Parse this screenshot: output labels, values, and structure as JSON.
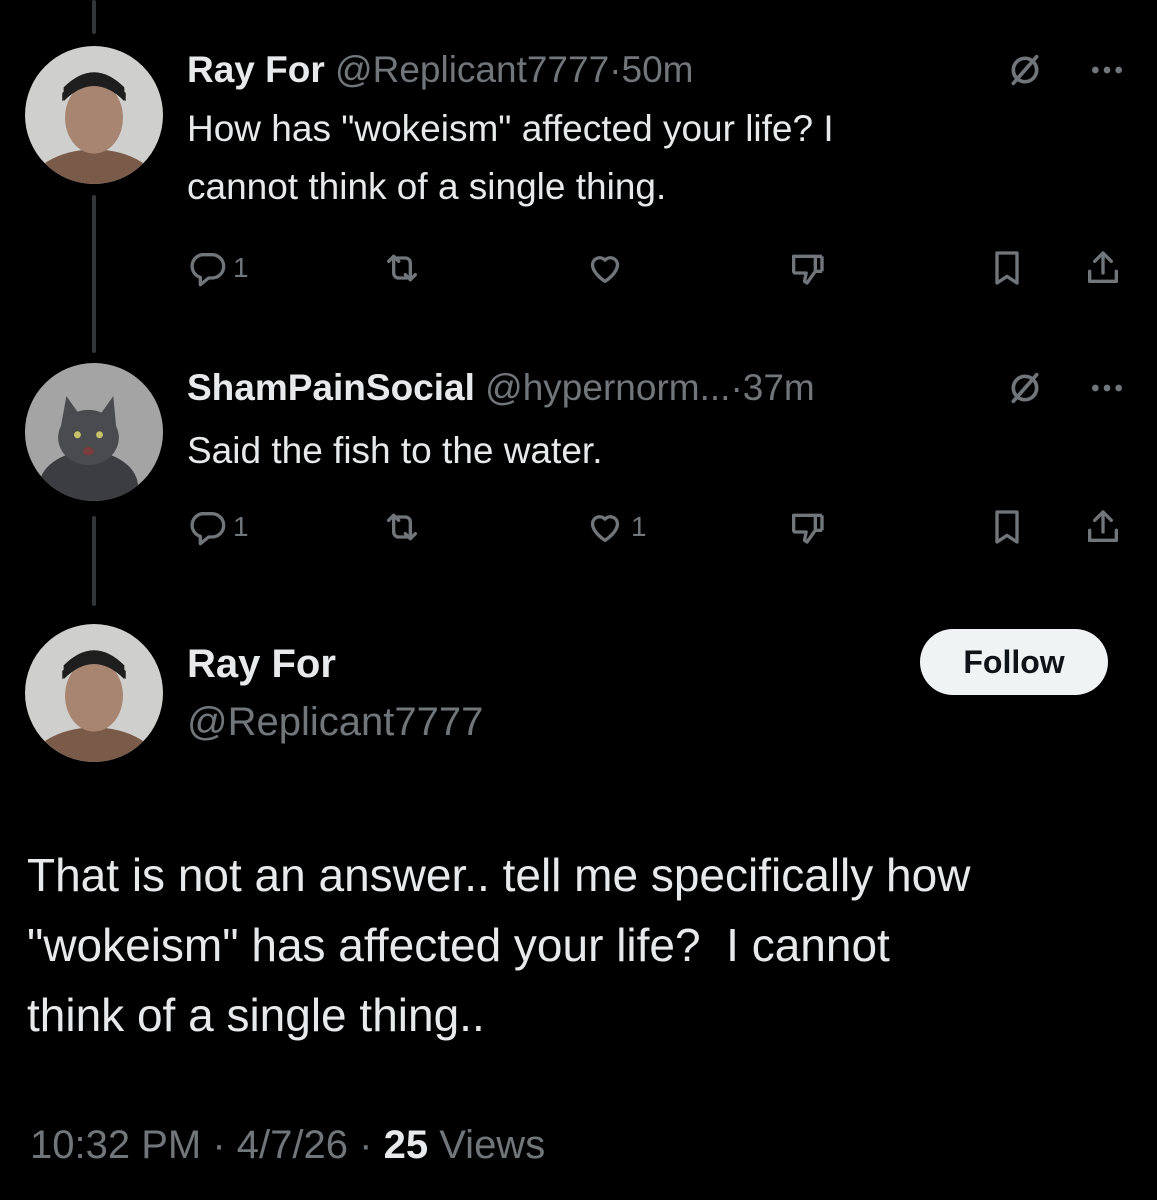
{
  "tweets": [
    {
      "name": "Ray For",
      "handle": "@Replicant7777",
      "sep": "·",
      "time": "50m",
      "text_lines": [
        "How has \"wokeism\" affected your life? I",
        "cannot think of a single thing."
      ],
      "reply_count": "1",
      "like_count": ""
    },
    {
      "name": "ShamPainSocial",
      "handle": "@hypernorm...",
      "sep": "·",
      "time": "37m",
      "text_lines": [
        "Said the fish to the water."
      ],
      "reply_count": "1",
      "like_count": "1"
    }
  ],
  "main": {
    "name": "Ray For",
    "handle": "@Replicant7777",
    "follow_label": "Follow",
    "text_lines": [
      "That is not an answer.. tell me specifically how",
      "\"wokeism\" has affected your life?  I cannot",
      "think of a single thing.."
    ],
    "time": "10:32 PM",
    "sep1": "·",
    "date": "4/7/26",
    "sep2": "·",
    "views_count": "25",
    "views_label": "Views"
  },
  "icons": {
    "reply": "reply-icon",
    "repost": "repost-icon",
    "like": "heart-icon",
    "downvote": "downvote-icon",
    "bookmark": "bookmark-icon",
    "share": "share-icon",
    "grok": "grok-icon",
    "more": "more-icon"
  },
  "colors": {
    "background": "#000000",
    "text": "#e7e9ea",
    "muted": "#71767b",
    "follow_bg": "#eff3f4"
  }
}
